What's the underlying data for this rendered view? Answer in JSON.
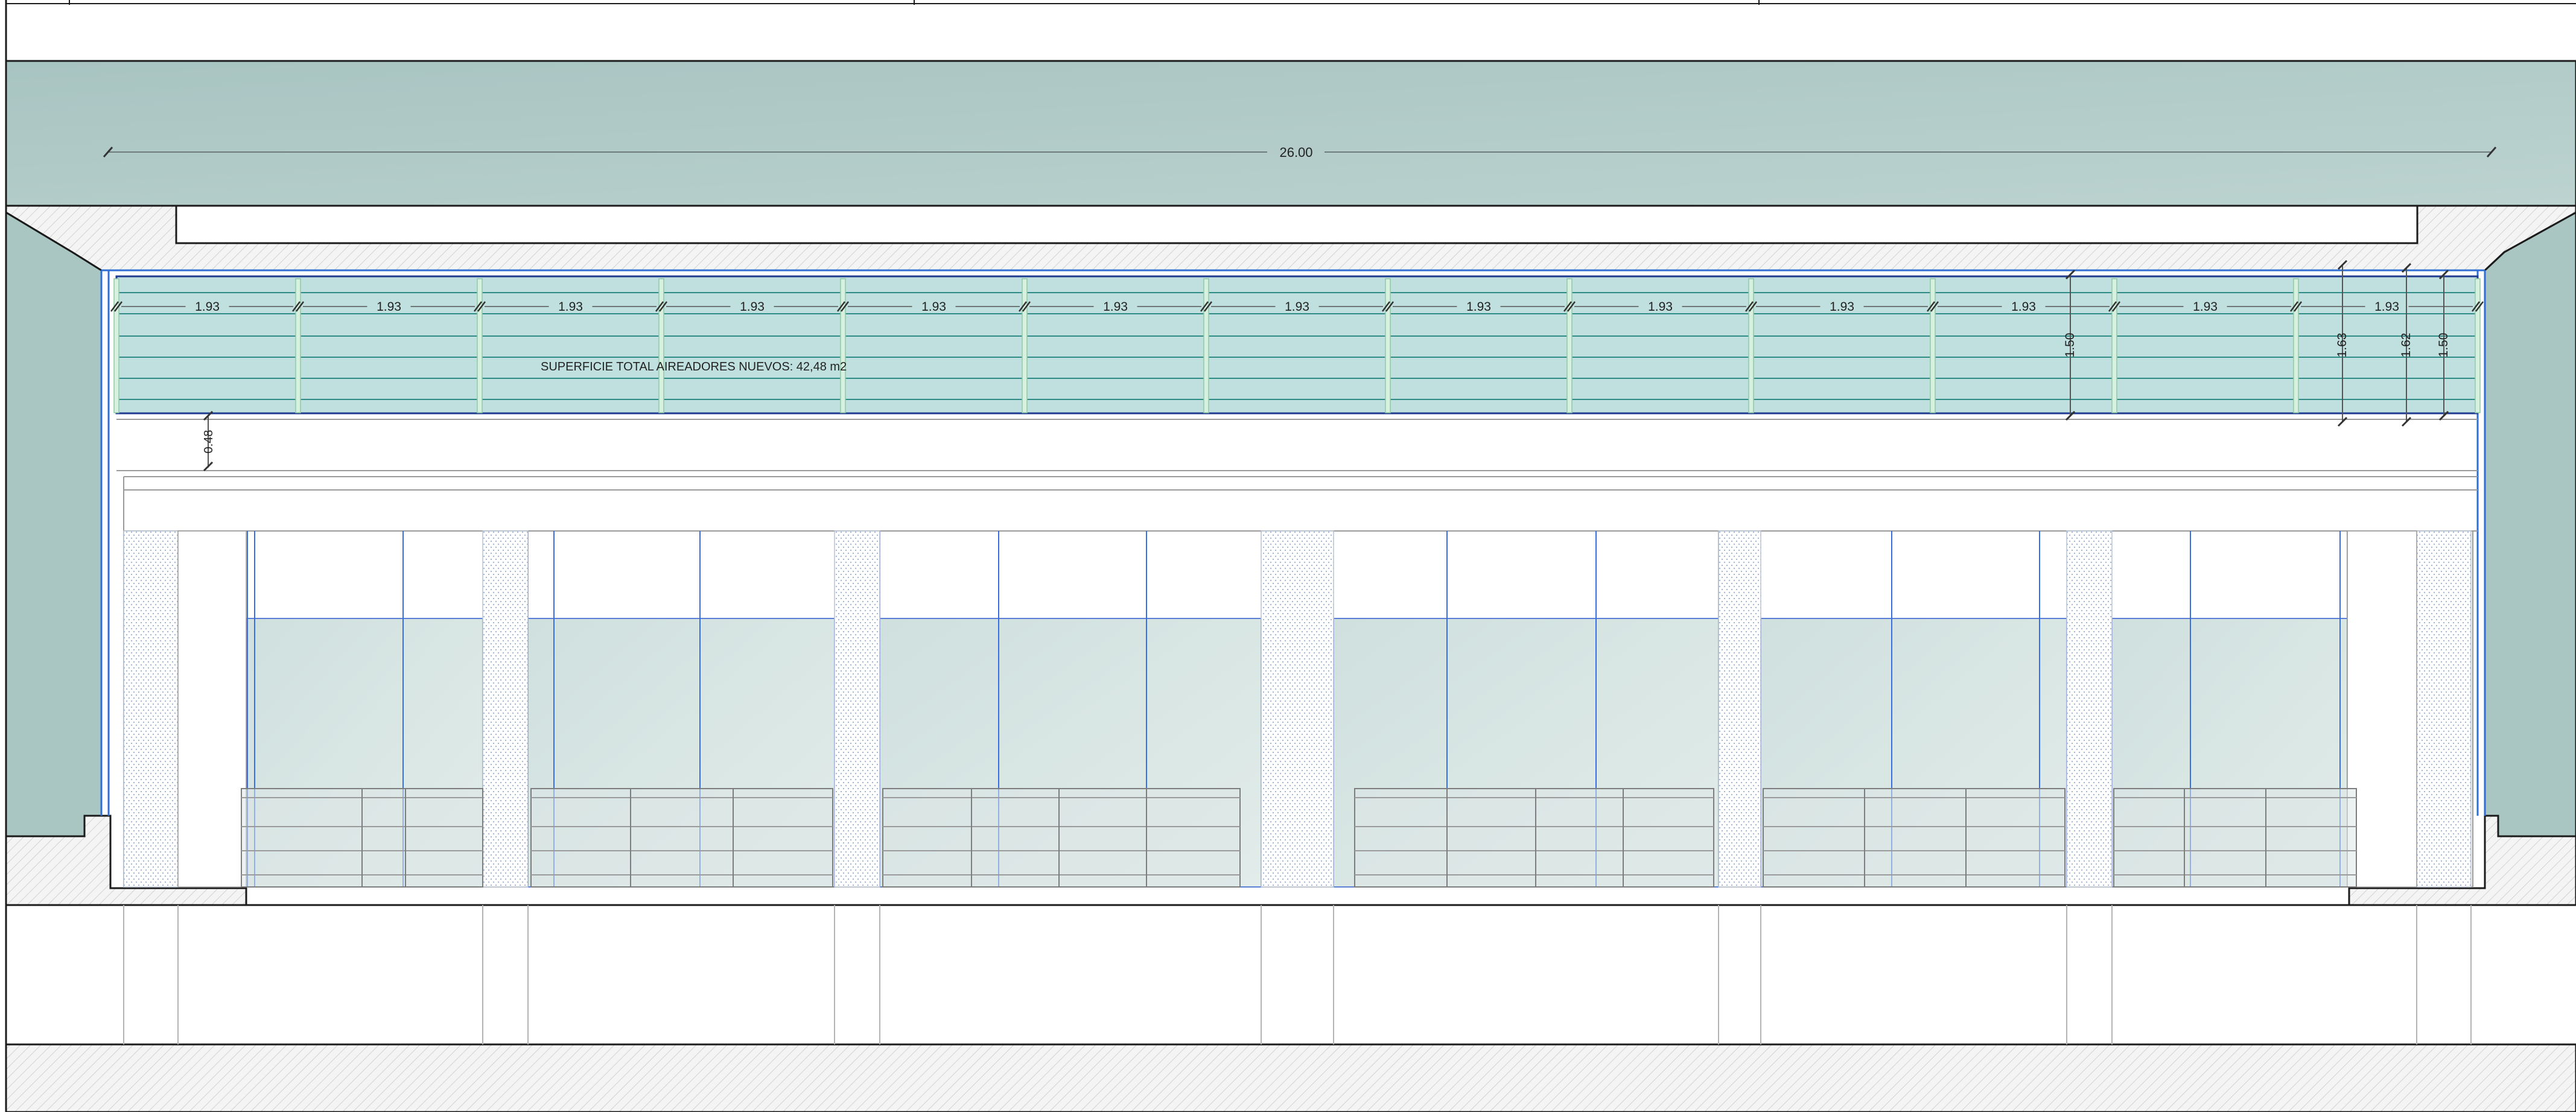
{
  "drawing": {
    "overall_dimension": "26.00",
    "panel_width_label": "1.93",
    "panel_count": 13,
    "vertical_dimensions": [
      "1.50",
      "1.63",
      "1.62",
      "1.50"
    ],
    "offset_dimension": "0.48",
    "area_note": "SUPERFICIE TOTAL AIREADORES NUEVOS: 42,48 m2"
  },
  "colors": {
    "roof_fill": "#b3cbc8",
    "louver_fill": "#bfe0df",
    "glass_fill": "#d6e5e3",
    "frame_blue": "#2f6fd3",
    "line_dark": "#1b1b1b"
  }
}
